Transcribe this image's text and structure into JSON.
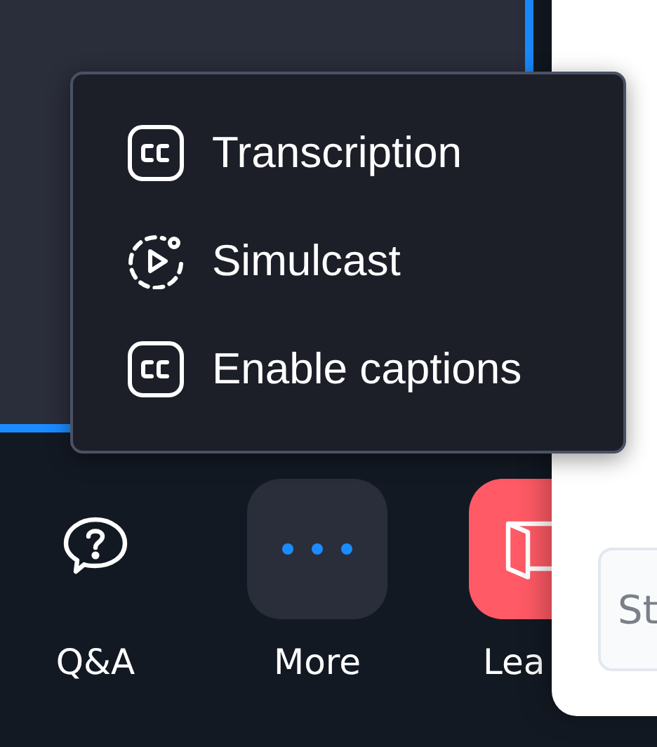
{
  "menu": {
    "items": [
      {
        "kind": "captions",
        "label": "Transcription"
      },
      {
        "kind": "simulcast",
        "label": "Simulcast"
      },
      {
        "kind": "captions",
        "label": "Enable captions"
      }
    ]
  },
  "toolbar": [
    {
      "kind": "qa",
      "label": "Q&A"
    },
    {
      "kind": "more",
      "label": "More"
    },
    {
      "kind": "leave",
      "label": "Lea"
    }
  ],
  "side_panel": {
    "field": {
      "placeholder": "St"
    }
  }
}
